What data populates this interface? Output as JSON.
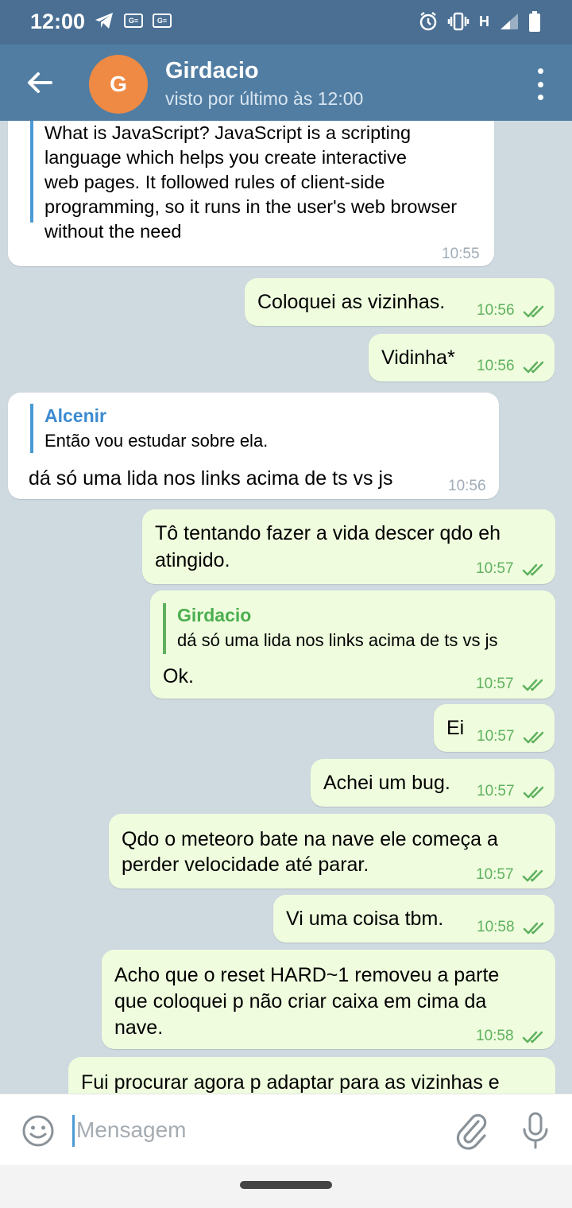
{
  "status_bar": {
    "time": "12:00",
    "network": "H",
    "battery": "47",
    "icons": [
      "telegram-icon",
      "notification-icon",
      "notification-icon",
      "alarm-icon",
      "vibrate-icon",
      "signal-icon",
      "battery-icon"
    ]
  },
  "header": {
    "avatar_letter": "G",
    "name": "Girdacio",
    "status": "visto por último às 12:00",
    "colors": {
      "bar": "#517da2",
      "avatar": "#ef8a44"
    }
  },
  "messages": [
    {
      "direction": "in",
      "lines": [
        "What is JavaScript? JavaScript is a scripting",
        "language which helps you create interactive",
        "web pages. It followed rules of client-side",
        "programming, so it runs in the user's web browser",
        "without the need"
      ],
      "time": "10:55"
    },
    {
      "direction": "out",
      "text": "Coloquei as vizinhas.",
      "time": "10:56"
    },
    {
      "direction": "out",
      "text": "Vidinha*",
      "time": "10:56"
    },
    {
      "direction": "in",
      "reply_to": {
        "name": "Alcenir",
        "text": "Então vou estudar sobre ela."
      },
      "text": "dá só uma lida nos links acima de ts vs js",
      "time": "10:56"
    },
    {
      "direction": "out",
      "lines": [
        "Tô tentando fazer a vida descer qdo eh",
        "atingido."
      ],
      "time": "10:57"
    },
    {
      "direction": "out",
      "reply_to": {
        "name": "Girdacio",
        "text": "dá só uma lida nos links acima de ts vs js"
      },
      "text": "Ok.",
      "time": "10:57"
    },
    {
      "direction": "out",
      "text": "Ei",
      "time": "10:57"
    },
    {
      "direction": "out",
      "text": "Achei um bug.",
      "time": "10:57"
    },
    {
      "direction": "out",
      "lines": [
        "Qdo o meteoro bate na nave ele começa a",
        "perder velocidade até parar."
      ],
      "time": "10:57"
    },
    {
      "direction": "out",
      "text": "Vi uma coisa tbm.",
      "time": "10:58"
    },
    {
      "direction": "out",
      "lines": [
        "Acho que o reset HARD~1 removeu a parte",
        "que coloquei p não criar caixa em cima da",
        "nave."
      ],
      "time": "10:58"
    },
    {
      "direction": "out",
      "text": "Fui procurar agora p adaptar para as vizinhas e"
    }
  ],
  "input": {
    "placeholder": "Mensagem"
  },
  "colors": {
    "chat_background": "#cfd9e0",
    "incoming_bubble": "#ffffff",
    "outgoing_bubble": "#effdde",
    "read_ticks": "#5fb15f",
    "quote_in": "#4a9ad4",
    "quote_out": "#5fb15f"
  }
}
